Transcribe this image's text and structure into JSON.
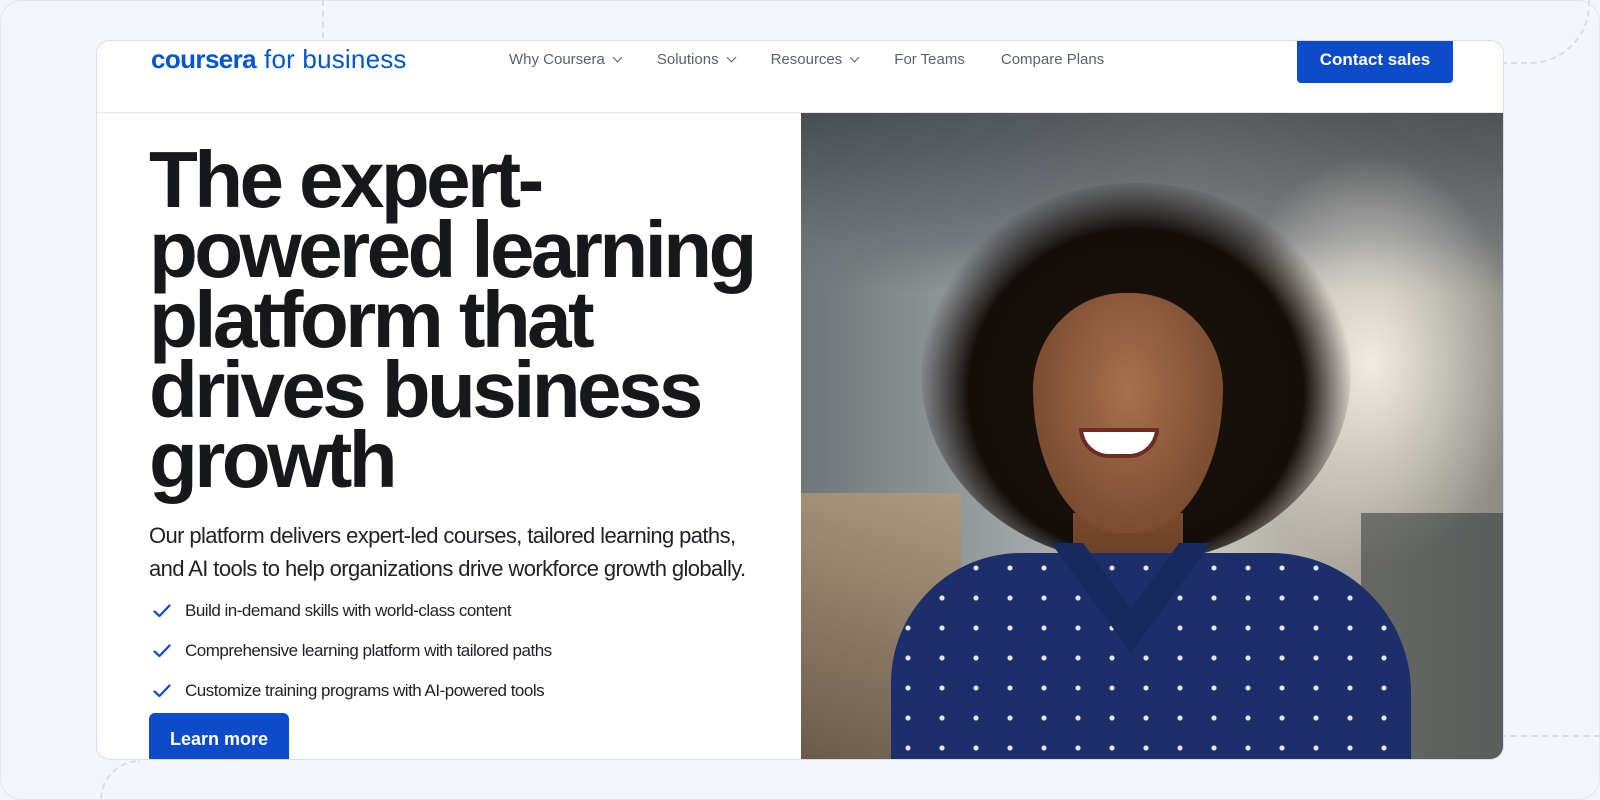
{
  "header": {
    "logo_main": "coursera",
    "logo_sub": "for business",
    "nav": [
      {
        "label": "Why Coursera",
        "has_dropdown": true
      },
      {
        "label": "Solutions",
        "has_dropdown": true
      },
      {
        "label": "Resources",
        "has_dropdown": true
      },
      {
        "label": "For Teams",
        "has_dropdown": false
      },
      {
        "label": "Compare Plans",
        "has_dropdown": false
      }
    ],
    "contact_label": "Contact sales"
  },
  "hero": {
    "headline": "The expert-powered learning platform that drives business growth",
    "subcopy": "Our platform delivers expert-led courses, tailored learning paths, and AI tools to help organizations drive workforce growth globally.",
    "bullets": [
      "Build in-demand skills with world-class content",
      "Comprehensive learning platform with tailored paths",
      "Customize training programs with AI-powered tools"
    ],
    "cta_label": "Learn more",
    "photo_icon": "hero-photo"
  },
  "colors": {
    "brand_blue": "#0056d2",
    "button_blue": "#0c4ccb",
    "headline_text": "#17181c"
  }
}
